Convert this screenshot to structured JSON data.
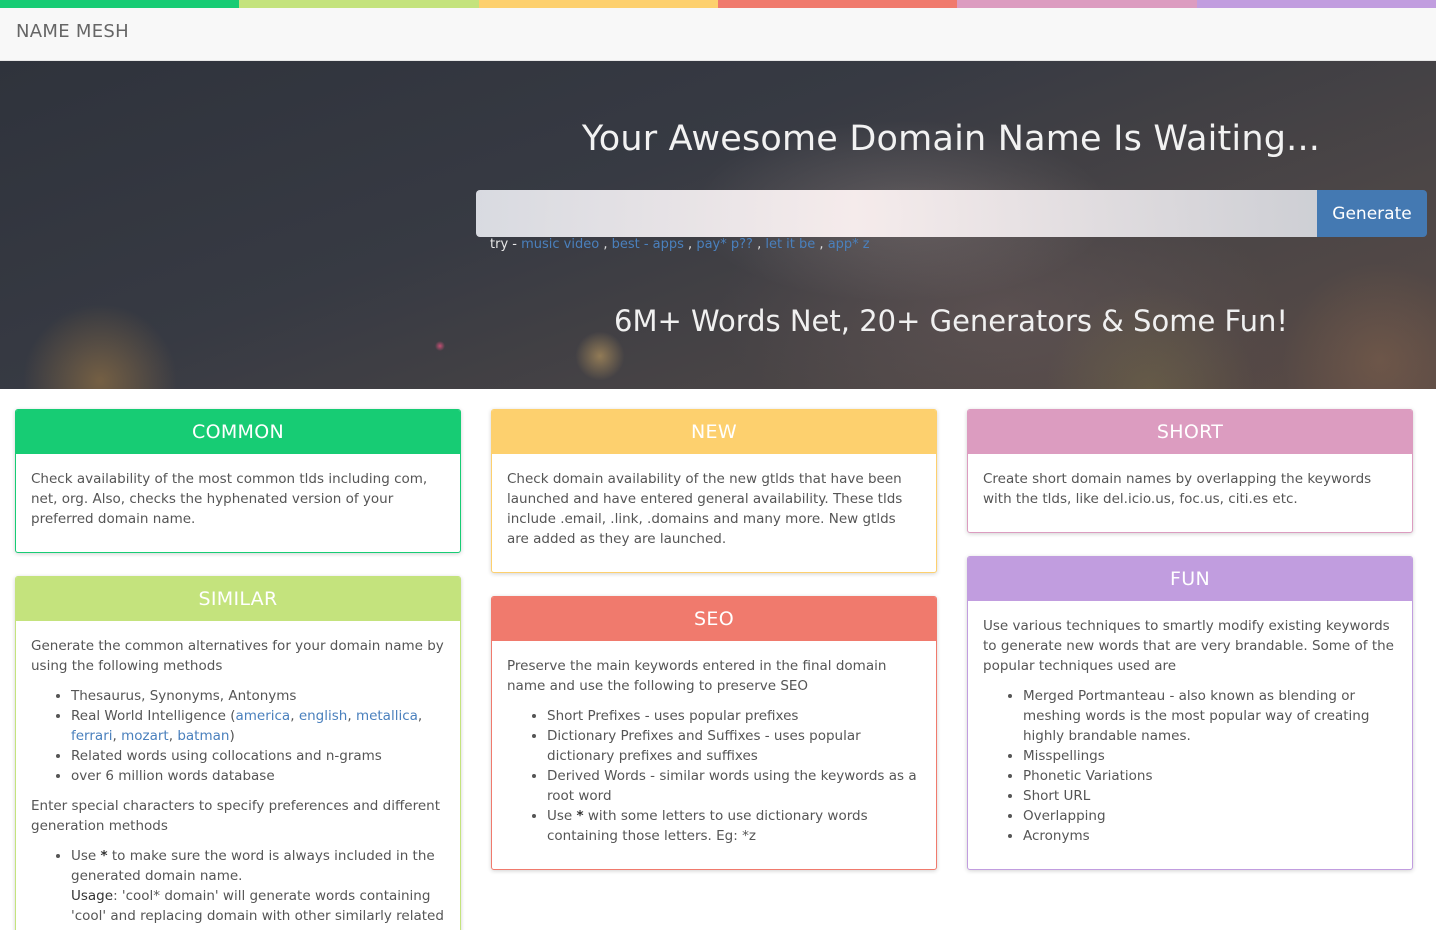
{
  "colors": {
    "strip": [
      "#17cc74",
      "#c4e37d",
      "#fdd06e",
      "#f07a6d",
      "#dc9cc0",
      "#c19ddf"
    ],
    "common": "#17cc74",
    "similar": "#c4e37d",
    "new": "#fdd06e",
    "seo": "#f07a6d",
    "short": "#dc9cc0",
    "fun": "#c19ddf",
    "button": "#4479b2"
  },
  "navbar": {
    "brand": "NAME MESH"
  },
  "hero": {
    "title": "Your Awesome Domain Name Is Waiting...",
    "search_value": "",
    "generate_label": "Generate",
    "try_label": "try -",
    "examples": [
      "music video",
      "best - apps",
      "pay* p??",
      "let it be",
      "app* z"
    ],
    "subtitle": "6M+ Words Net, 20+ Generators & Some Fun!"
  },
  "panels": {
    "common": {
      "title": "COMMON",
      "text": "Check availability of the most common tlds including com, net, org. Also, checks the hyphenated version of your preferred domain name."
    },
    "new": {
      "title": "NEW",
      "text": "Check domain availability of the new gtlds that have been launched and have entered general availability. These tlds include .email, .link, .domains and many more. New gtlds are added as they are launched."
    },
    "short": {
      "title": "SHORT",
      "text": "Create short domain names by overlapping the keywords with the tlds, like del.icio.us, foc.us, citi.es etc."
    },
    "similar": {
      "title": "SIMILAR",
      "intro": "Generate the common alternatives for your domain name by using the following methods",
      "items": {
        "thesaurus": "Thesaurus, Synonyms, Antonyms",
        "rwi_label": "Real World Intelligence (",
        "rwi_links": [
          "america",
          "english",
          "metallica",
          "ferrari",
          "mozart",
          "batman"
        ],
        "rwi_close": ")",
        "related": "Related words using collocations and n-grams",
        "database": "over 6 million words database"
      },
      "special_intro": "Enter special characters to specify preferences and different generation methods",
      "special": {
        "use_label": "Use",
        "star": "*",
        "use_rest": "to make sure the word is always included in the generated domain name.",
        "usage_label": "Usage",
        "usage_text": ": 'cool* domain' will generate words containing 'cool' and replacing domain with other similarly related words."
      }
    },
    "seo": {
      "title": "SEO",
      "intro": "Preserve the main keywords entered in the final domain name and use the following to preserve SEO",
      "items": [
        "Short Prefixes - uses popular prefixes",
        "Dictionary Prefixes and Suffixes - uses popular dictionary prefixes and suffixes",
        "Derived Words - similar words using the keywords as a root word"
      ],
      "star_item": {
        "use_label": "Use",
        "star": "*",
        "rest": "with some letters to use dictionary words containing those letters. Eg: *z"
      }
    },
    "fun": {
      "title": "FUN",
      "intro": "Use various techniques to smartly modify existing keywords to generate new words that are very brandable. Some of the popular techniques used are",
      "items": [
        "Merged Portmanteau - also known as blending or meshing words is the most popular way of creating highly brandable names.",
        "Misspellings",
        "Phonetic Variations",
        "Short URL",
        "Overlapping",
        "Acronyms"
      ]
    }
  }
}
